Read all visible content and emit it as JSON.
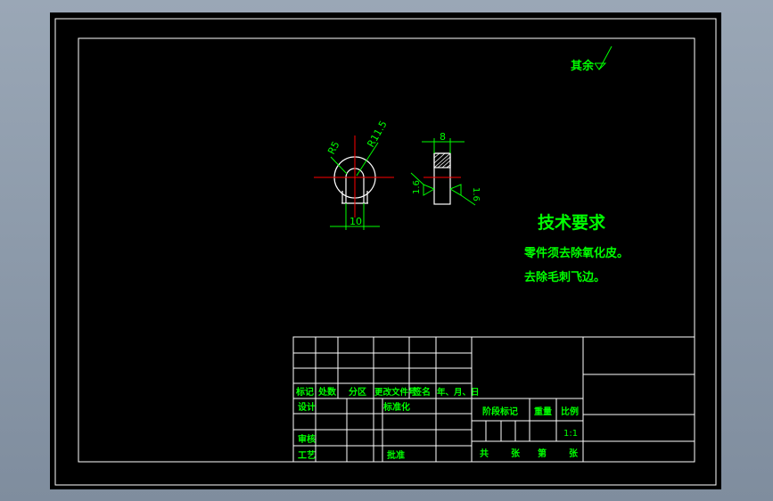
{
  "surface_note": {
    "label": "其余"
  },
  "dimensions": {
    "radius_small": "R5",
    "radius_large": "R11.5",
    "width_bottom": "10",
    "thickness_top": "8",
    "roughness_left": "1.6",
    "roughness_right": "1.6"
  },
  "tech_requirements": {
    "title": "技术要求",
    "lines": [
      "零件须去除氧化皮。",
      "去除毛刺飞边。"
    ]
  },
  "title_block": {
    "rev_headers": [
      "标记",
      "处数",
      "分区",
      "更改文件号",
      "签名",
      "年、月、日"
    ],
    "sign_labels": [
      "设计",
      "标准化",
      "审核",
      "工艺",
      "批准"
    ],
    "stage_label": "阶段标记",
    "weight_label": "重量",
    "scale_label": "比例",
    "scale_value": "1:1",
    "sheet_labels": [
      "共",
      "张",
      "第",
      "张"
    ]
  },
  "colors": {
    "background": "#000000",
    "frame_lines": "#ffffff",
    "text": "#00ff00",
    "dimension_lines": "#00ff00",
    "center_lines": "#ff0000",
    "frame_bg": "#8f9cad"
  }
}
